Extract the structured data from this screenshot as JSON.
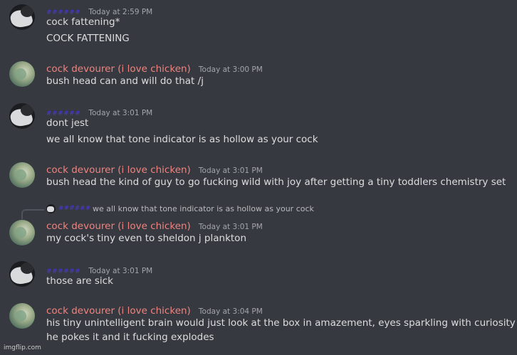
{
  "messages": [
    {
      "user": "######",
      "time": "Today at 2:59 PM",
      "lines": [
        "cock fattening*",
        "COCK FATTENING"
      ]
    },
    {
      "user": "cock devourer (i love chicken)",
      "time": "Today at 3:00 PM",
      "lines": [
        "bush head can and will do that /j"
      ]
    },
    {
      "user": "######",
      "time": "Today at 3:01 PM",
      "lines": [
        "dont jest",
        "we all know that tone indicator is as hollow as your cock"
      ]
    },
    {
      "user": "cock devourer (i love chicken)",
      "time": "Today at 3:01 PM",
      "lines": [
        "bush head the kind of guy to go fucking wild with joy after getting a tiny toddlers chemistry set"
      ]
    },
    {
      "reply_user": "######",
      "reply_text": "we all know that tone indicator is as hollow as your cock",
      "user": "cock devourer (i love chicken)",
      "time": "Today at 3:01 PM",
      "lines": [
        "my cock's tiny even to sheldon j plankton"
      ]
    },
    {
      "user": "######",
      "time": "Today at 3:01 PM",
      "lines": [
        "those are sick"
      ]
    },
    {
      "user": "cock devourer (i love chicken)",
      "time": "Today at 3:04 PM",
      "lines": [
        "his tiny unintelligent brain would just look at the box in amazement, eyes sparkling with curiosity as",
        "he pokes it and it fucking explodes"
      ]
    }
  ],
  "watermark": "imgflip.com",
  "colors": {
    "background": "#36393f",
    "text": "#dcddde",
    "timestamp": "#a3a6aa",
    "username_red": "#f0837f",
    "username_blue": "#4a3ad6"
  }
}
